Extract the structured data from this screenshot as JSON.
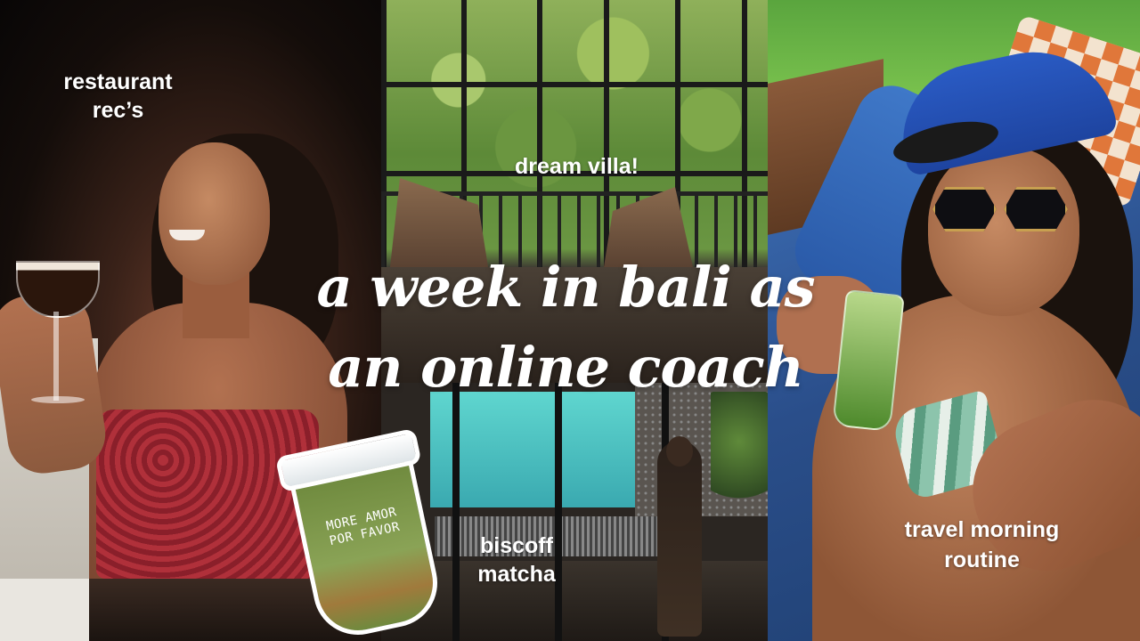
{
  "title": {
    "line1": "a week in bali as",
    "line2": "an online coach"
  },
  "panels": {
    "left": {
      "caption_line1": "restaurant",
      "caption_line2": "rec’s"
    },
    "middle_top": {
      "caption": "dream villa!"
    },
    "middle_bottom": {
      "caption_line1": "biscoff",
      "caption_line2": "matcha"
    },
    "right": {
      "caption_line1": "travel morning",
      "caption_line2": "routine"
    }
  },
  "cup": {
    "label_line1": "MORE AMOR",
    "label_line2": "POR FAVOR"
  }
}
